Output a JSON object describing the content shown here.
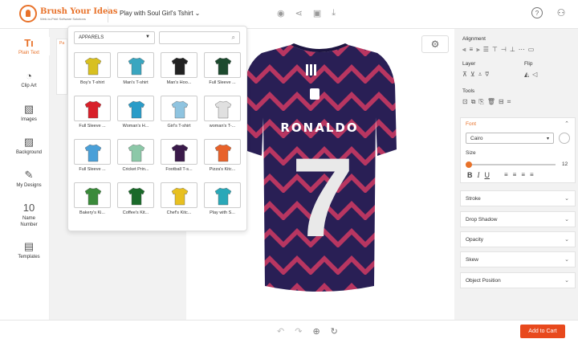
{
  "brand": {
    "name": "Brush Your Ideas",
    "tagline": "Web-to-Print Software Solutions"
  },
  "header": {
    "product_title": "Play with Soul Girl's Tshirt"
  },
  "sidebar": {
    "items": [
      {
        "label": "Plain Text",
        "icon": "text-icon"
      },
      {
        "label": "Clip Art",
        "icon": "clipart-icon"
      },
      {
        "label": "Images",
        "icon": "image-icon"
      },
      {
        "label": "Background",
        "icon": "background-icon"
      },
      {
        "label": "My Designs",
        "icon": "designs-icon"
      },
      {
        "label": "Name Number",
        "icon": "number-icon"
      },
      {
        "label": "Templates",
        "icon": "templates-icon"
      }
    ]
  },
  "panel_strip": {
    "label": "Pa"
  },
  "popup": {
    "category": "APPARELS",
    "search_placeholder": "",
    "products": [
      {
        "label": "Boy's T-shirt",
        "color": "#d8c020"
      },
      {
        "label": "Man's T-shirt",
        "color": "#3aa6c0"
      },
      {
        "label": "Man's Hoo...",
        "color": "#222222"
      },
      {
        "label": "Full Sleeve ...",
        "color": "#1c4a2e"
      },
      {
        "label": "Full Sleeve ...",
        "color": "#d8202a"
      },
      {
        "label": "Woman's H...",
        "color": "#2a9cc8"
      },
      {
        "label": "Girl's T-shirt",
        "color": "#8fc4e0"
      },
      {
        "label": "woman's T-...",
        "color": "#e0e0e0"
      },
      {
        "label": "Full Sleeve ...",
        "color": "#4aa0d8"
      },
      {
        "label": "Cricket Prin...",
        "color": "#8cc8a8"
      },
      {
        "label": "Football T-s...",
        "color": "#3a1a4a"
      },
      {
        "label": "Pizza's Kitc...",
        "color": "#e8622a"
      },
      {
        "label": "Bakery's Ki...",
        "color": "#3a8a3a"
      },
      {
        "label": "Coffee's Kit...",
        "color": "#1a6a2a"
      },
      {
        "label": "Chef's Kitc...",
        "color": "#e8c020"
      },
      {
        "label": "Play with S...",
        "color": "#2aa8b8"
      }
    ]
  },
  "jersey": {
    "name": "RONALDO",
    "number": "7",
    "colors": {
      "base": "#2a1f55",
      "stripe": "#d23a63"
    }
  },
  "right": {
    "alignment": "Alignment",
    "layer": "Layer",
    "flip": "Flip",
    "tools": "Tools",
    "font": {
      "title": "Font",
      "family": "Cairo",
      "size_label": "Size",
      "size_value": "12",
      "style_b": "B",
      "style_i": "I",
      "style_u": "U"
    },
    "sections": [
      "Stroke",
      "Drop Shadow",
      "Opacity",
      "Skew",
      "Object Position"
    ]
  },
  "footer": {
    "add_to_cart": "Add to Cart"
  },
  "colors": {
    "accent": "#e8722a",
    "cart": "#e8491d"
  }
}
